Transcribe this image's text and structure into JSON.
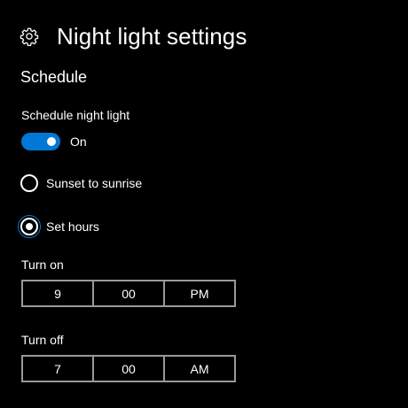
{
  "header": {
    "icon": "gear-icon",
    "title": "Night light settings"
  },
  "schedule": {
    "section_title": "Schedule",
    "toggle_label": "Schedule night light",
    "toggle_state": "On",
    "toggle_on": true,
    "accent_color": "#0078d7",
    "options": [
      {
        "label": "Sunset to sunrise",
        "selected": false
      },
      {
        "label": "Set hours",
        "selected": true
      }
    ]
  },
  "turn_on": {
    "label": "Turn on",
    "hour": "9",
    "minute": "00",
    "period": "PM"
  },
  "turn_off": {
    "label": "Turn off",
    "hour": "7",
    "minute": "00",
    "period": "AM"
  }
}
